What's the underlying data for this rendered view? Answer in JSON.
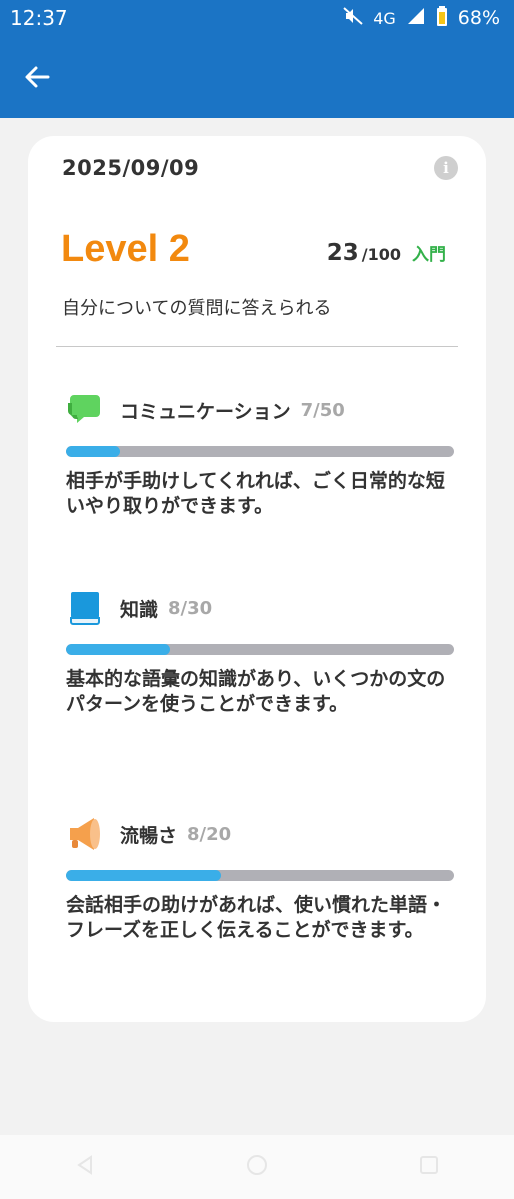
{
  "status": {
    "time": "12:37",
    "network": "4G",
    "battery": "68%"
  },
  "card": {
    "date": "2025/09/09",
    "level": "Level 2",
    "score": "23",
    "score_max": "/100",
    "rank": "入門",
    "level_description": "自分についての質問に答えられる"
  },
  "skills": [
    {
      "name": "コミュニケーション",
      "score": "7/50",
      "progress": 0.14,
      "icon": "chat-bubbles-icon",
      "color": "#4cc94f",
      "description": "相手が手助けしてくれれば、ごく日常的な短いやり取りができます。"
    },
    {
      "name": "知識",
      "score": "8/30",
      "progress": 0.267,
      "icon": "book-icon",
      "color": "#1a98dc",
      "description": "基本的な語彙の知識があり、いくつかの文のパターンを使うことができます。"
    },
    {
      "name": "流暢さ",
      "score": "8/20",
      "progress": 0.4,
      "icon": "megaphone-icon",
      "color": "#f5a04c",
      "description": "会話相手の助けがあれば、使い慣れた単語・フレーズを正しく伝えることができます。"
    }
  ],
  "colors": {
    "app_bar": "#1b74c5",
    "level": "#f2890f",
    "rank": "#33b14a",
    "bar_fill": "#3aaee8",
    "bar_track": "#b0b0b6"
  }
}
